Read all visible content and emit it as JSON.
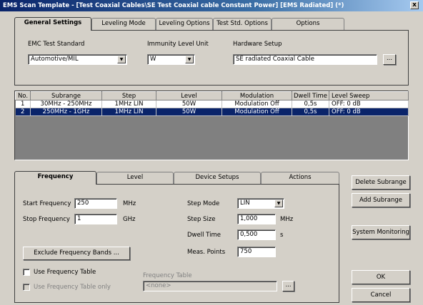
{
  "window": {
    "title": "EMS Scan Template - [Test Coaxial Cables\\SE Test Coaxial cable Constant Power] [EMS Radiated] (*)",
    "close_glyph": "x"
  },
  "top_tabs": [
    {
      "label": "General Settings"
    },
    {
      "label": "Leveling Mode"
    },
    {
      "label": "Leveling Options"
    },
    {
      "label": "Test Std. Options"
    },
    {
      "label": "Options"
    }
  ],
  "general": {
    "emc_label": "EMC Test Standard",
    "emc_value": "Automotive/MIL",
    "unit_label": "Immunity Level Unit",
    "unit_value": "W",
    "hw_label": "Hardware Setup",
    "hw_value": "SE radiated Coaxial Cable",
    "browse_label": "..."
  },
  "subrange_table": {
    "columns": [
      "No.",
      "Subrange",
      "Step",
      "Level",
      "Modulation",
      "Dwell Time",
      "Level Sweep"
    ],
    "rows": [
      {
        "no": "1",
        "subrange": "30MHz - 250MHz",
        "step": "1MHz LIN",
        "level": "50W",
        "modulation": "Modulation Off",
        "dwell": "0,5s",
        "sweep": "OFF: 0 dB"
      },
      {
        "no": "2",
        "subrange": "250MHz - 1GHz",
        "step": "1MHz LIN",
        "level": "50W",
        "modulation": "Modulation Off",
        "dwell": "0,5s",
        "sweep": "OFF: 0 dB"
      }
    ]
  },
  "bottom_tabs": [
    {
      "label": "Frequency"
    },
    {
      "label": "Level"
    },
    {
      "label": "Device Setups"
    },
    {
      "label": "Actions"
    }
  ],
  "frequency": {
    "start_label": "Start Frequency",
    "start_value": "250",
    "start_unit": "MHz",
    "stop_label": "Stop Frequency",
    "stop_value": "1",
    "stop_unit": "GHz",
    "step_mode_label": "Step Mode",
    "step_mode_value": "LIN",
    "step_size_label": "Step Size",
    "step_size_value": "1,000",
    "step_size_unit": "MHz",
    "dwell_label": "Dwell Time",
    "dwell_value": "0,500",
    "dwell_unit": "s",
    "meas_label": "Meas. Points",
    "meas_value": "750",
    "exclude_button": "Exclude Frequency Bands ...",
    "use_table_label": "Use Frequency Table",
    "use_table_only_label": "Use Frequency Table only",
    "freq_table_label": "Frequency Table",
    "freq_table_value": "<none>",
    "freq_table_browse": "..."
  },
  "side_buttons": {
    "delete": "Delete Subrange",
    "add": "Add Subrange",
    "monitoring": "System Monitoring",
    "ok": "OK",
    "cancel": "Cancel"
  }
}
